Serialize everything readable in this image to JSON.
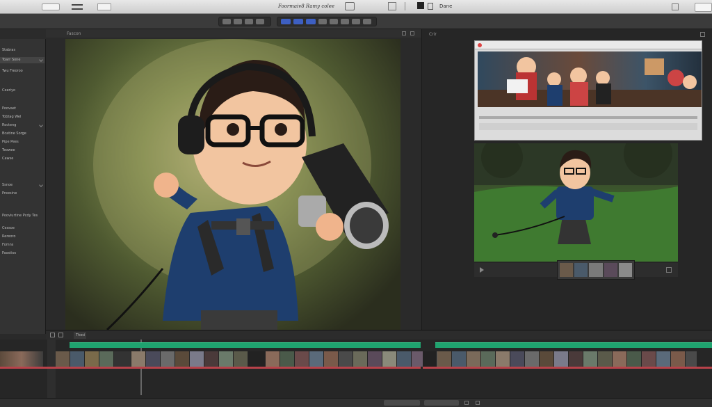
{
  "window": {
    "title": "Foormaiv8 Ramy colee",
    "done_label": "Dane"
  },
  "colors": {
    "accent_blue": "#3d5fc2",
    "timeline_green": "#1fa36f",
    "clip_red": "#b8424a"
  },
  "sidebar": {
    "items": [
      {
        "label": "Stabras"
      },
      {
        "label": "Toarr Sone"
      },
      {
        "label": "Twu Freoroo"
      },
      {
        "label": "Ceeriyo"
      },
      {
        "label": "Poovaet"
      },
      {
        "label": "Tobtag Wel"
      },
      {
        "label": "Rocteng"
      },
      {
        "label": "Bcatine Sorge"
      },
      {
        "label": "Pipe Pees"
      },
      {
        "label": "Teowee"
      },
      {
        "label": "Cawse"
      },
      {
        "label": "Ssnoe"
      },
      {
        "label": "Preesine"
      },
      {
        "label": "Pooviurtine Pcdy Tes"
      },
      {
        "label": "Cessoe"
      },
      {
        "label": "Rereoro"
      },
      {
        "label": "Fomns"
      },
      {
        "label": "Faostios"
      }
    ]
  },
  "viewer": {
    "header_label": "Fascon"
  },
  "right_panel": {
    "header_label": "Crir"
  },
  "timeline": {
    "tab_label": "Thosi"
  }
}
